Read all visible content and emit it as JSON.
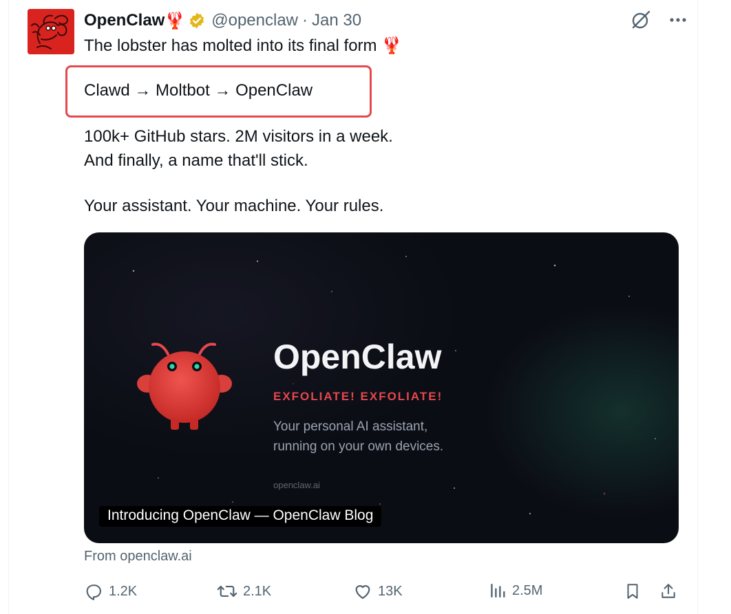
{
  "tweet": {
    "display_name": "OpenClaw",
    "name_emoji": "🦞",
    "handle": "@openclaw",
    "separator": "·",
    "date": "Jan 30",
    "lines": {
      "l1": "The lobster has molted into its final form 🦞",
      "l2": "Clawd → Moltbot → OpenClaw",
      "l3": "100k+ GitHub stars. 2M visitors in a week.",
      "l4": "And finally, a name that'll stick.",
      "l5": "Your assistant. Your machine. Your rules."
    },
    "highlight_color": "#e5484d"
  },
  "card": {
    "brand": "OpenClaw",
    "tagline": "EXFOLIATE! EXFOLIATE!",
    "desc_line1": "Your personal AI assistant,",
    "desc_line2": "running on your own devices.",
    "site": "openclaw.ai",
    "title": "Introducing OpenClaw — OpenClaw Blog",
    "from": "From openclaw.ai"
  },
  "actions": {
    "replies": "1.2K",
    "reposts": "2.1K",
    "likes": "13K",
    "views": "2.5M"
  },
  "icons": [
    "verified-badge-icon",
    "grok-icon",
    "more-icon",
    "reply-icon",
    "repost-icon",
    "like-icon",
    "views-icon",
    "bookmark-icon",
    "share-icon"
  ],
  "colors": {
    "text": "#0f1419",
    "secondary": "#536471",
    "verified_gold": "#e2b719",
    "brand_red": "#e5484d",
    "card_bg": "#0b0d14"
  }
}
